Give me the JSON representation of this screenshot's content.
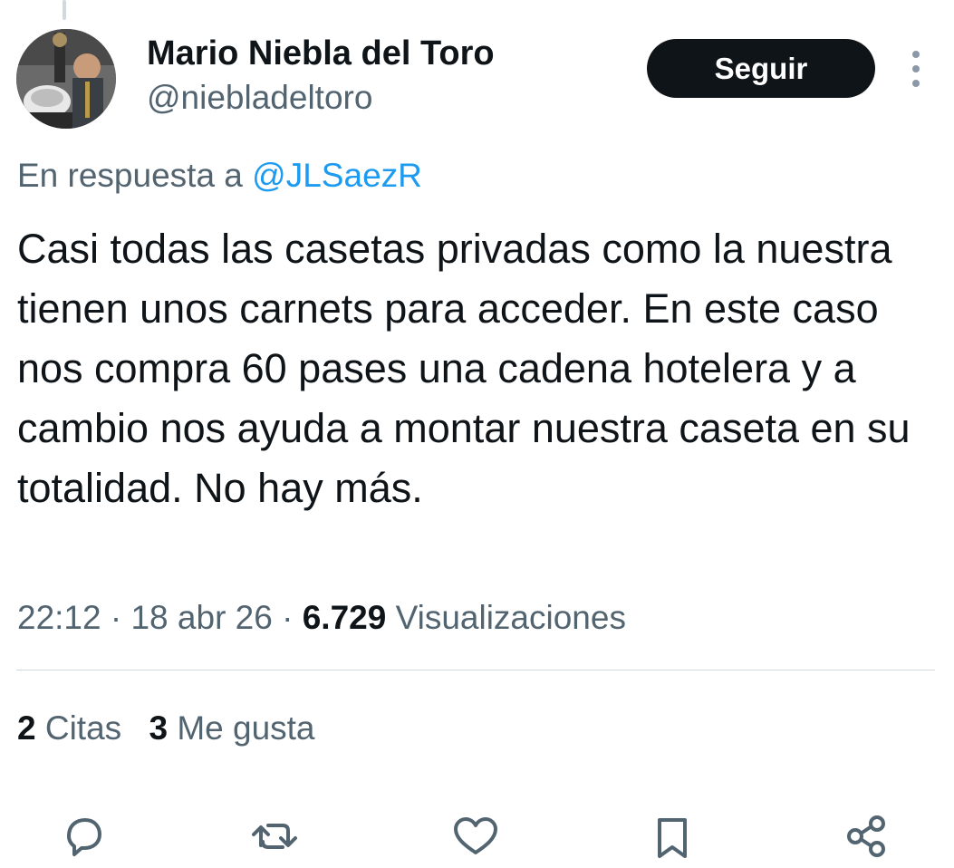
{
  "tweet": {
    "author_name": "Mario Niebla del Toro",
    "author_handle": "@niebladeltoro",
    "follow_label": "Seguir",
    "reply_prefix": "En respuesta a",
    "reply_mention": "@JLSaezR",
    "text": "Casi todas las casetas privadas como la nuestra tienen unos carnets para acceder. En este caso nos compra 60 pases una cadena hotelera y a cambio nos ayuda a montar nuestra caseta en su totalidad. No hay más.",
    "time": "22:12",
    "date": "18 abr 26",
    "separator": "·",
    "views_count": "6.729",
    "views_label": "Visualizaciones"
  },
  "stats": {
    "quotes_count": "2",
    "quotes_label": "Citas",
    "likes_count": "3",
    "likes_label": "Me gusta"
  },
  "icons": {
    "more": "more-vertical-icon",
    "reply": "reply-icon",
    "retweet": "retweet-icon",
    "like": "heart-icon",
    "bookmark": "bookmark-icon",
    "share": "share-icon"
  },
  "colors": {
    "text": "#0f1419",
    "secondary": "#536471",
    "link": "#1d9bf0",
    "button_bg": "#0f1419",
    "divider": "#cfd9de"
  }
}
